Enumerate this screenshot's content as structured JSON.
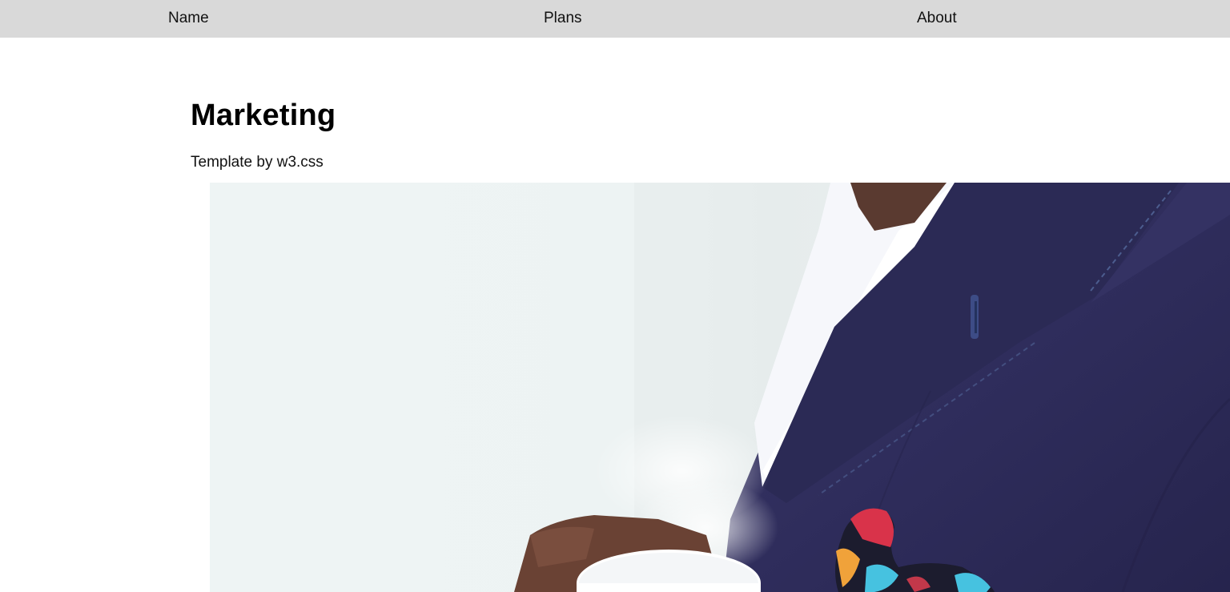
{
  "nav": {
    "items": [
      {
        "label": "Name"
      },
      {
        "label": "Plans"
      },
      {
        "label": "About"
      }
    ]
  },
  "header": {
    "title": "Marketing",
    "subtitle": "Template by w3.css"
  },
  "hero": {
    "image": "man-in-suit-holding-coffee-cup",
    "colors": {
      "background": "#eef4f4",
      "suit": "#2f2e5c",
      "shirt": "#f7f8fc",
      "skin": "#6a4234"
    }
  },
  "colors": {
    "nav_background": "#d9d9d9",
    "page_background": "#ffffff",
    "text": "#000000"
  }
}
